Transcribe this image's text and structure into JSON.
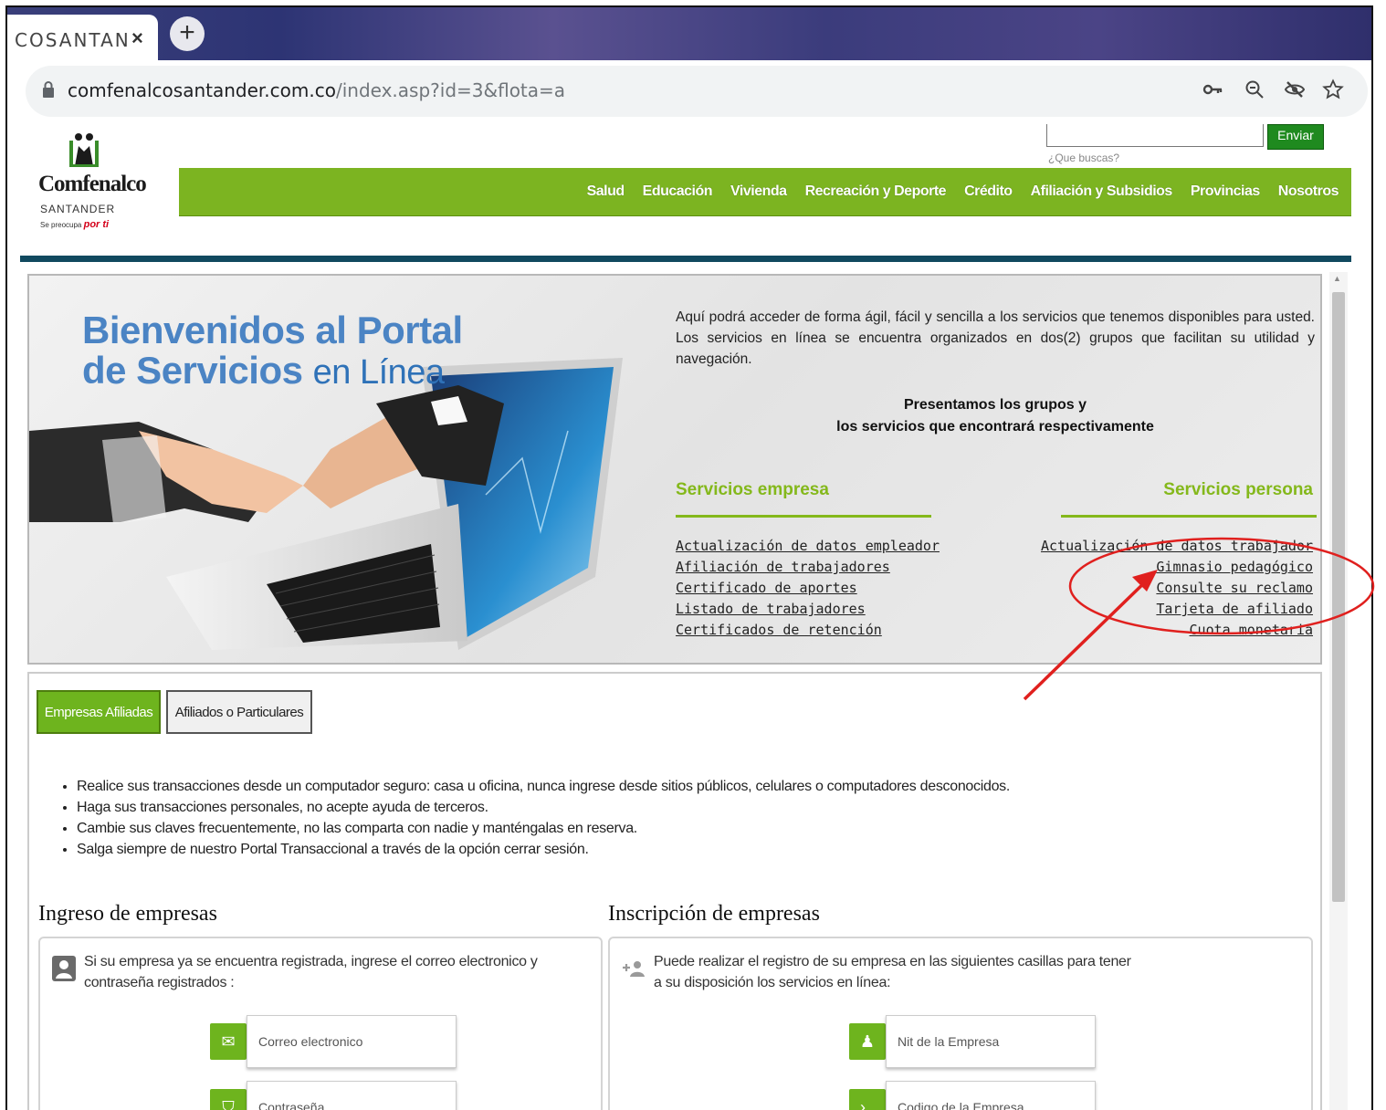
{
  "browser": {
    "tab_title": "COSANTAN",
    "tab_close": "×",
    "new_tab": "+",
    "url_domain": "comfenalcosantander.com.co",
    "url_path": "/index.asp?id=3&flota=a",
    "icons": [
      "key-icon",
      "zoom-icon",
      "eye-off-icon",
      "star-icon"
    ]
  },
  "site": {
    "logo_name": "Comfenalco",
    "logo_sub": "SANTANDER",
    "logo_tagline_start": "Se preocupa",
    "logo_tagline_end": "por ti",
    "search_button": "Enviar",
    "search_hint": "¿Que buscas?",
    "nav": [
      "Salud",
      "Educación",
      "Vivienda",
      "Recreación y Deporte",
      "Crédito",
      "Afiliación y Subsidios",
      "Provincias",
      "Nosotros"
    ],
    "accent_green": "#7cb421",
    "rule_color": "#11495f"
  },
  "banner": {
    "title_line1": "Bienvenidos al Portal",
    "title_line2_bold": "de Servicios",
    "title_line2_light": "en Línea",
    "intro": "Aquí podrá acceder de forma ágil, fácil y sencilla a los servicios que tenemos disponibles para usted. Los servicios en línea se encuentra organizados en dos(2) grupos que facilitan su utilidad y navegación.",
    "present_line1": "Presentamos los grupos y",
    "present_line2": "los servicios que encontrará respectivamente",
    "empresa": {
      "heading": "Servicios empresa",
      "links": [
        "Actualización de datos empleador",
        "Afiliación de trabajadores",
        "Certificado de aportes",
        "Listado de trabajadores",
        "Certificados de retención"
      ]
    },
    "persona": {
      "heading": "Servicios persona",
      "links": [
        "Actualización de datos trabajador",
        "Gimnasio pedagógico",
        "Consulte su reclamo",
        "Tarjeta de afiliado",
        "Cuota monetaria"
      ]
    }
  },
  "panel": {
    "tabs": [
      "Empresas Afiliadas",
      "Afiliados o Particulares"
    ],
    "tips": [
      "Realice sus transacciones desde un computador seguro: casa u oficina, nunca ingrese desde sitios públicos, celulares o computadores desconocidos.",
      "Haga sus transacciones personales, no acepte ayuda de terceros.",
      "Cambie sus claves frecuentemente, no las comparta con nadie y manténgalas en reserva.",
      "Salga siempre de nuestro Portal Transaccional a través de la opción cerrar sesión."
    ],
    "ingreso": {
      "title": "Ingreso de empresas",
      "text_line1": "Si su empresa ya se encuentra registrada, ingrese el correo electronico y",
      "text_line2": "contraseña registrados :",
      "email_placeholder": "Correo electronico",
      "password_placeholder": "Contraseña"
    },
    "inscripcion": {
      "title": "Inscripción de empresas",
      "text_line1": "Puede realizar el registro de su empresa en las siguientes casillas para tener",
      "text_line2": "a su disposición los servicios en línea:",
      "nit_placeholder": "Nit de la Empresa",
      "code_placeholder": "Codigo de la Empresa"
    }
  },
  "annotation_color": "#e0201e"
}
